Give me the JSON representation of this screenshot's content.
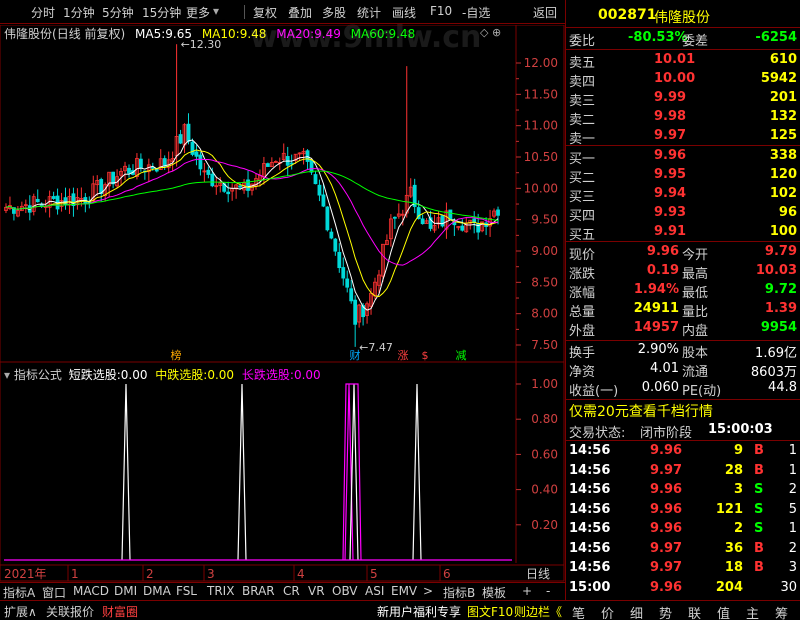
{
  "toolbar": {
    "logo": "",
    "items": [
      "分时",
      "1分钟",
      "5分钟",
      "15分钟",
      "更多",
      "复权",
      "叠加",
      "多股",
      "统计",
      "画线",
      "F10",
      "-自选",
      "返回"
    ]
  },
  "chart_header": {
    "name": "伟隆股份",
    "mode": "(日线 前复权)",
    "ma5_label": "MA5:",
    "ma5_value": "9.65",
    "ma10_label": "MA10:",
    "ma10_value": "9.48",
    "ma20_label": "MA20:",
    "ma20_value": "9.49",
    "ma60_label": "MA60:",
    "ma60_value": "9.48",
    "watermark": "www.9mlw.cn"
  },
  "price_axis": [
    "12.00",
    "11.50",
    "11.00",
    "10.50",
    "10.00",
    "9.50",
    "9.00",
    "8.50",
    "8.00",
    "7.50"
  ],
  "annotations": {
    "high": "12.30",
    "low": "7.47",
    "markers": [
      "榜",
      "财",
      "涨",
      "$",
      "减"
    ]
  },
  "indicator_header": {
    "label": "指标公式",
    "s1_label": "短跌选股:",
    "s1_value": "0.00",
    "s2_label": "中跌选股:",
    "s2_value": "0.00",
    "s3_label": "长跌选股:",
    "s3_value": "0.00"
  },
  "indicator_axis": [
    "1.00",
    "0.80",
    "0.60",
    "0.40",
    "0.20"
  ],
  "date_axis": {
    "year": "2021年",
    "months": [
      "1",
      "2",
      "3",
      "4",
      "5",
      "6"
    ],
    "period": "日线"
  },
  "tabs": [
    "指标A",
    "窗口",
    "MACD",
    "DMI",
    "DMA",
    "FSL",
    "TRIX",
    "BRAR",
    "CR",
    "VR",
    "OBV",
    "ASI",
    "EMV",
    ">",
    "指标B",
    "模板",
    "+",
    "-"
  ],
  "quote": {
    "code": "002871",
    "name": "伟隆股份",
    "weibi_label": "委比",
    "weibi": "-80.53%",
    "weicha_label": "委差",
    "weicha": "-6254",
    "asks": [
      {
        "label": "卖五",
        "price": "10.01",
        "vol": "610"
      },
      {
        "label": "卖四",
        "price": "10.00",
        "vol": "5942"
      },
      {
        "label": "卖三",
        "price": "9.99",
        "vol": "201"
      },
      {
        "label": "卖二",
        "price": "9.98",
        "vol": "132"
      },
      {
        "label": "卖一",
        "price": "9.97",
        "vol": "125"
      }
    ],
    "bids": [
      {
        "label": "买一",
        "price": "9.96",
        "vol": "338"
      },
      {
        "label": "买二",
        "price": "9.95",
        "vol": "120"
      },
      {
        "label": "买三",
        "price": "9.94",
        "vol": "102"
      },
      {
        "label": "买四",
        "price": "9.93",
        "vol": "96"
      },
      {
        "label": "买五",
        "price": "9.91",
        "vol": "100"
      }
    ],
    "stats": [
      {
        "l1": "现价",
        "v1": "9.96",
        "l2": "今开",
        "v2": "9.79"
      },
      {
        "l1": "涨跌",
        "v1": "0.19",
        "l2": "最高",
        "v2": "10.03"
      },
      {
        "l1": "涨幅",
        "v1": "1.94%",
        "l2": "最低",
        "v2": "9.72"
      },
      {
        "l1": "总量",
        "v1": "24911",
        "l2": "量比",
        "v2": "1.39"
      },
      {
        "l1": "外盘",
        "v1": "14957",
        "l2": "内盘",
        "v2": "9954"
      }
    ],
    "fin": [
      {
        "l1": "换手",
        "v1": "2.90%",
        "l2": "股本",
        "v2": "1.69亿"
      },
      {
        "l1": "净资",
        "v1": "4.01",
        "l2": "流通",
        "v2": "8603万"
      },
      {
        "l1": "收益(一)",
        "v1": "0.060",
        "l2": "PE(动)",
        "v2": "44.8"
      }
    ],
    "promo": "仅需20元查看千档行情",
    "status_label": "交易状态:",
    "status": "闭市阶段",
    "status_time": "15:00:03",
    "ticks": [
      {
        "t": "14:56",
        "p": "9.96",
        "v": "9",
        "d": "B",
        "n": "1"
      },
      {
        "t": "14:56",
        "p": "9.97",
        "v": "28",
        "d": "B",
        "n": "1"
      },
      {
        "t": "14:56",
        "p": "9.96",
        "v": "3",
        "d": "S",
        "n": "2"
      },
      {
        "t": "14:56",
        "p": "9.96",
        "v": "121",
        "d": "S",
        "n": "5"
      },
      {
        "t": "14:56",
        "p": "9.96",
        "v": "2",
        "d": "S",
        "n": "1"
      },
      {
        "t": "14:56",
        "p": "9.97",
        "v": "36",
        "d": "B",
        "n": "2"
      },
      {
        "t": "14:56",
        "p": "9.97",
        "v": "18",
        "d": "B",
        "n": "3"
      },
      {
        "t": "15:00",
        "p": "9.96",
        "v": "204",
        "d": "",
        "n": "30"
      }
    ]
  },
  "bottom": {
    "left": [
      "扩展∧",
      "关联报价",
      "财富圈"
    ],
    "right": [
      "新用户福利专享",
      "图文F10",
      "则边栏《"
    ],
    "keys": [
      "笔",
      "价",
      "细",
      "势",
      "联",
      "值",
      "主",
      "筹"
    ]
  },
  "colors": {
    "up": "#ff3232",
    "down": "#00d8d8",
    "ma5": "#ffffff",
    "ma10": "#ffff00",
    "ma20": "#ff00ff",
    "ma60": "#00ff00",
    "border": "#7a0000"
  }
}
